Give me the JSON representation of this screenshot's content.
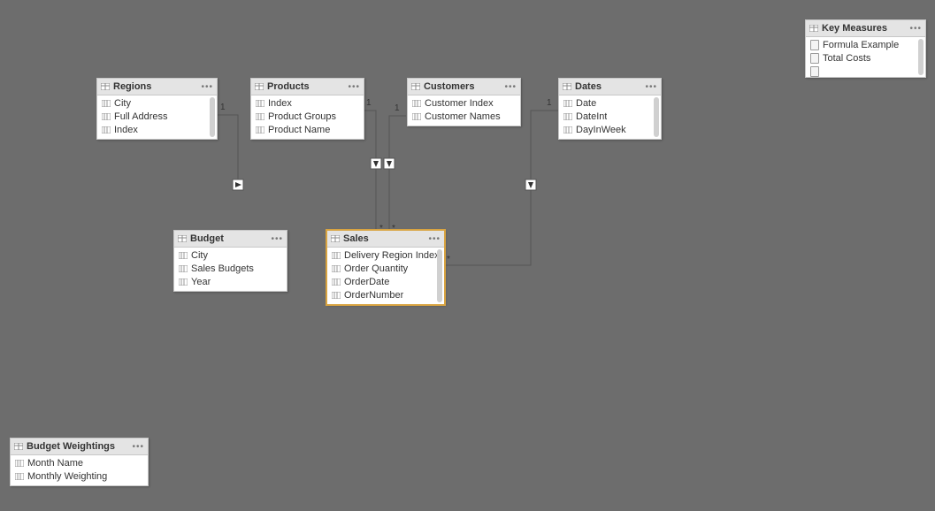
{
  "tables": {
    "regions": {
      "title": "Regions",
      "fields": [
        "City",
        "Full Address",
        "Index"
      ]
    },
    "products": {
      "title": "Products",
      "fields": [
        "Index",
        "Product Groups",
        "Product Name"
      ]
    },
    "customers": {
      "title": "Customers",
      "fields": [
        "Customer Index",
        "Customer Names"
      ]
    },
    "dates": {
      "title": "Dates",
      "fields": [
        "Date",
        "DateInt",
        "DayInWeek"
      ]
    },
    "budget": {
      "title": "Budget",
      "fields": [
        "City",
        "Sales Budgets",
        "Year"
      ]
    },
    "sales": {
      "title": "Sales",
      "fields": [
        "Delivery Region Index",
        "Order Quantity",
        "OrderDate",
        "OrderNumber"
      ]
    },
    "keymeasures": {
      "title": "Key Measures",
      "measures": [
        "Formula Example",
        "Total Costs"
      ]
    },
    "budgetweightings": {
      "title": "Budget Weightings",
      "fields": [
        "Month Name",
        "Monthly Weighting"
      ]
    }
  },
  "cardinality": {
    "one": "1",
    "many": "*"
  }
}
